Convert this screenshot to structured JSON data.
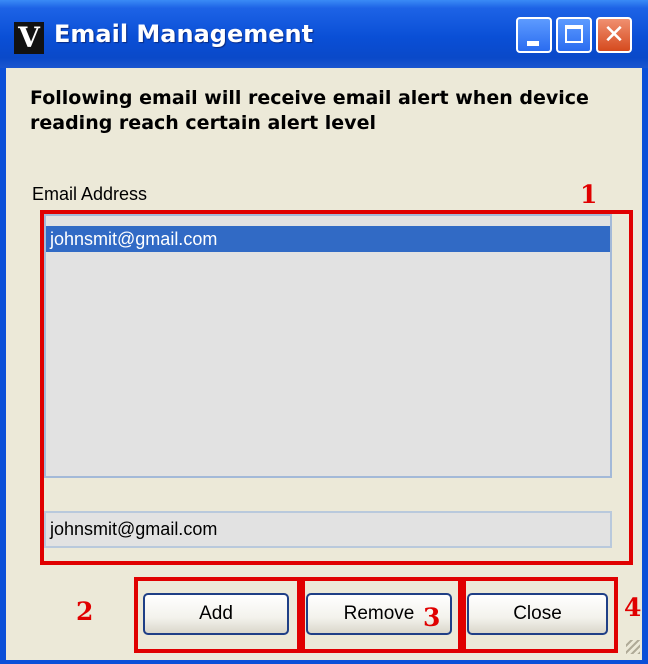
{
  "window": {
    "title": "Email Management",
    "app_icon_letter": "V",
    "colors": {
      "titlebar": "#0a4fd6",
      "client": "#ece9d8",
      "selection": "#316ac5",
      "annotation": "#e00000"
    }
  },
  "title_buttons": {
    "minimize_icon": "minimize-icon",
    "maximize_icon": "maximize-icon",
    "close_icon": "close-icon",
    "close_glyph": "✕"
  },
  "content": {
    "heading": "Following email will receive email alert when device reading reach certain alert level",
    "list_label": "Email Address",
    "emails": [
      "johnsmit@gmail.com"
    ],
    "selected_email_index": 0,
    "email_input_value": "johnsmit@gmail.com"
  },
  "buttons": {
    "add": "Add",
    "remove": "Remove",
    "close": "Close"
  },
  "annotations": [
    "1",
    "2",
    "3",
    "4"
  ]
}
